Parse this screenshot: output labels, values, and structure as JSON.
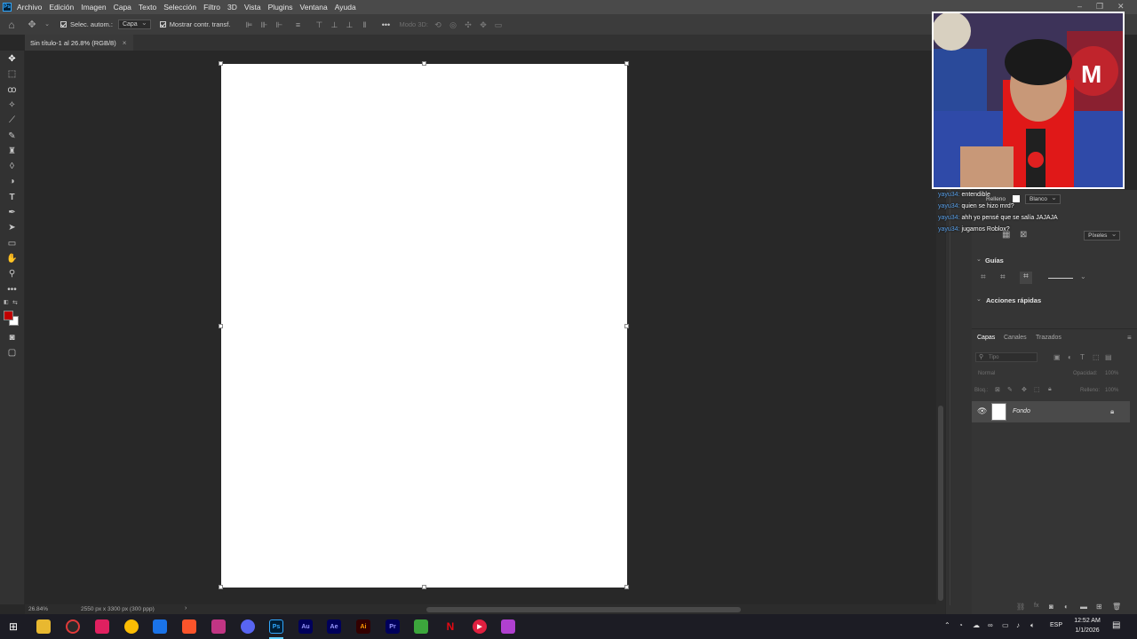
{
  "menubar": {
    "app_icon": "Ps",
    "items": [
      "Archivo",
      "Edición",
      "Imagen",
      "Capa",
      "Texto",
      "Selección",
      "Filtro",
      "3D",
      "Vista",
      "Plugins",
      "Ventana",
      "Ayuda"
    ]
  },
  "options": {
    "auto_select_label": "Selec. autom.:",
    "auto_select_value": "Capa",
    "show_transform_label": "Mostrar contr. transf.",
    "mode_3d_label": "Modo 3D:"
  },
  "document": {
    "tab_title": "Sin título-1 al 26.8% (RGB/8)",
    "zoom": "26.84%",
    "info": "2550 px x 3300 px (300 ppp)"
  },
  "props_panel": {
    "fill_label": "Relleno",
    "fill_value": "Blanco",
    "units_value": "Píxeles",
    "guides_title": "Guías",
    "quick_actions_title": "Acciones rápidas"
  },
  "layers_panel": {
    "tabs": [
      "Capas",
      "Canales",
      "Trazados"
    ],
    "search_placeholder": "Tipo",
    "blend_mode": "Normal",
    "opacity_label": "Opacidad:",
    "opacity_value": "100%",
    "lock_label": "Bloq.:",
    "fill_label": "Relleno:",
    "fill_value": "100%",
    "layers": [
      {
        "name": "Fondo"
      }
    ]
  },
  "chat": [
    {
      "user": "yayu34:",
      "message": "entendible"
    },
    {
      "user": "yayu34:",
      "message": "quien se hizo mrd?"
    },
    {
      "user": "yayu34:",
      "message": "ahh yo pensé que se salía JAJAJA"
    },
    {
      "user": "yayu34:",
      "message": "jugamos Roblox?"
    }
  ],
  "taskbar": {
    "apps": [
      "Au",
      "Ae",
      "Ai",
      "Pr"
    ],
    "app_ps": "Ps",
    "language": "ESP",
    "time": "12:52 AM",
    "date": "1/1/2026"
  },
  "colors": {
    "foreground": "#c00000",
    "background": "#ffffff",
    "accent": "#31a8ff"
  }
}
